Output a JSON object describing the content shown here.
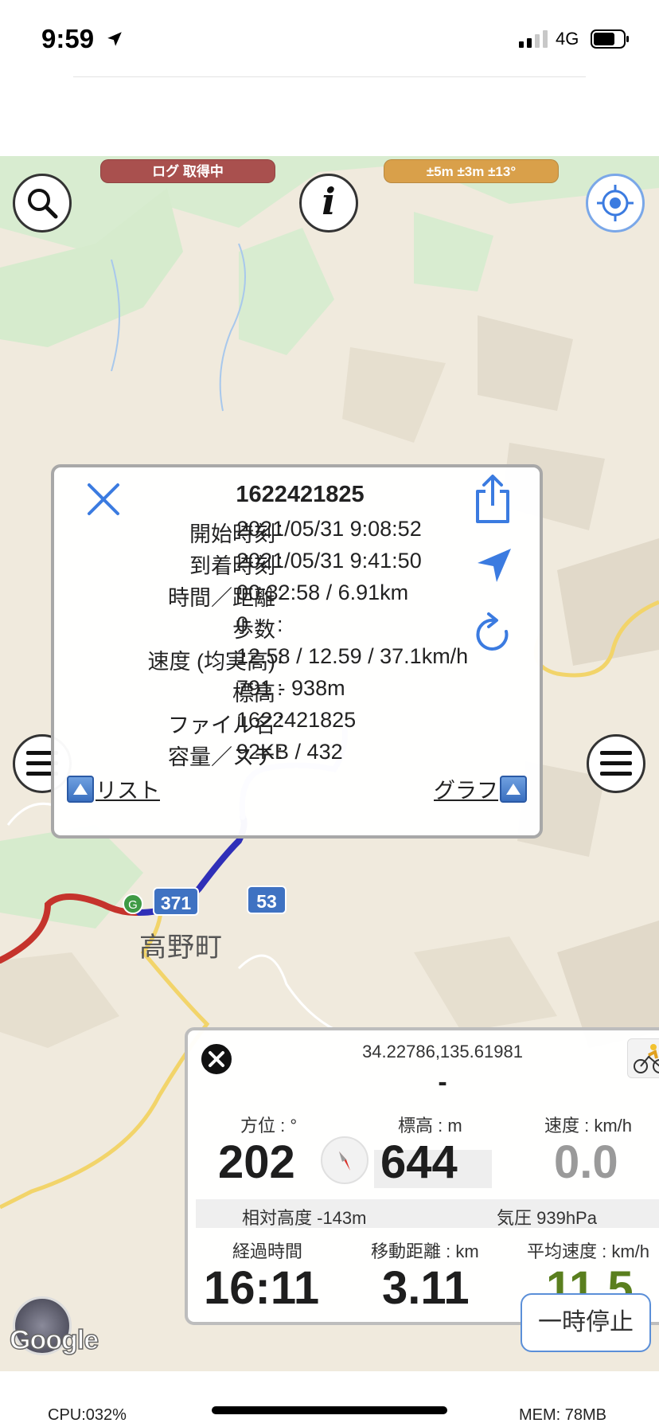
{
  "status_bar": {
    "time": "9:59",
    "network": "4G",
    "icons": [
      "location-arrow-icon",
      "signal-icon",
      "battery-icon"
    ]
  },
  "map": {
    "log_status": "ログ 取得中",
    "accuracy": "±5m ±3m ±13°",
    "town_label": "高野町",
    "route_badges": [
      "371",
      "53"
    ],
    "marker_letter": "G",
    "attribution": "Google"
  },
  "track_card": {
    "title": "1622421825",
    "rows": [
      {
        "label": "開始時刻",
        "value": "2021/05/31 9:08:52"
      },
      {
        "label": "到着時刻",
        "value": "2021/05/31 9:41:50"
      },
      {
        "label": "時間／距離",
        "value": "00:32:58 / 6.91km"
      },
      {
        "label": "歩数",
        "value": "0"
      },
      {
        "label": "速度 (均実高)",
        "value": "12.58 / 12.59 / 37.1km/h"
      },
      {
        "label": "標高",
        "value": "791 - 938m"
      },
      {
        "label": "ファイル名",
        "value": "1622421825"
      },
      {
        "label": "容量／ステ",
        "value": "92KB / 432"
      }
    ],
    "separator": ":",
    "list_link": "リスト",
    "graph_link": "グラフ"
  },
  "stats_panel": {
    "coords": "34.22786,135.61981",
    "address": "-",
    "heading_label": "方位 : °",
    "heading_value": "202",
    "altitude_label": "標高 : m",
    "altitude_value": "644",
    "speed_label": "速度 : km/h",
    "speed_value": "0.0",
    "relative_altitude": "相対高度 -143m",
    "pressure": "気圧 939hPa",
    "elapsed_label": "経過時間",
    "elapsed_value": "16:11",
    "distance_label": "移動距離 : km",
    "distance_value": "3.11",
    "avg_speed_label": "平均速度 : km/h",
    "avg_speed_value": "11.5"
  },
  "pause_button": "一時停止",
  "bottom_bar": {
    "cpu": "CPU:032%",
    "mem": "MEM: 78MB"
  },
  "colors": {
    "log_pill": "#a9504e",
    "accuracy_pill": "#d9a04a",
    "accent_blue": "#3b7be0",
    "track_red": "#c5332c",
    "track_blue": "#2f2fb8",
    "avg_speed_green": "#5a7f1e"
  }
}
